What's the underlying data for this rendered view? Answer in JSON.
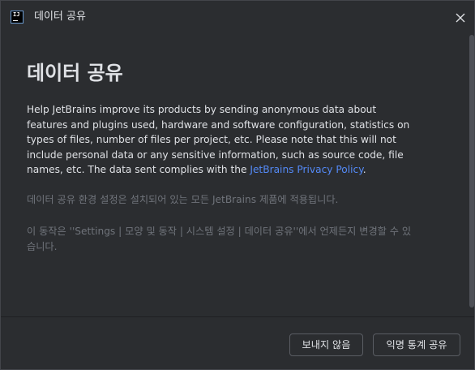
{
  "window": {
    "title": "데이터 공유",
    "app_icon_text": "IJ",
    "app_icon": "intellij-logo-icon",
    "close_icon": "close-icon"
  },
  "content": {
    "heading": "데이터 공유",
    "body_text": "Help JetBrains improve its products by sending anonymous data about features and plugins used, hardware and software configuration, statistics on types of files, number of files per project, etc. Please note that this will not include personal data or any sensitive information, such as source code, file names, etc. The data sent complies with the ",
    "policy_link": "JetBrains Privacy Policy",
    "body_text_end": ".",
    "note_scope": "데이터 공유 환경 설정은 설치되어 있는 모든 JetBrains 제품에 적용됩니다.",
    "note_change": "이 동작은 ''Settings | 모양 및 동작 | 시스템 설정 | 데이터 공유''에서 언제든지 변경할 수 있습니다."
  },
  "footer": {
    "decline_label": "보내지 않음",
    "share_label": "익명 통계 공유"
  },
  "colors": {
    "background": "#2b2d30",
    "text": "#dfe1e5",
    "muted_text": "#6f737a",
    "link": "#548af7",
    "border": "#5a5d63"
  }
}
